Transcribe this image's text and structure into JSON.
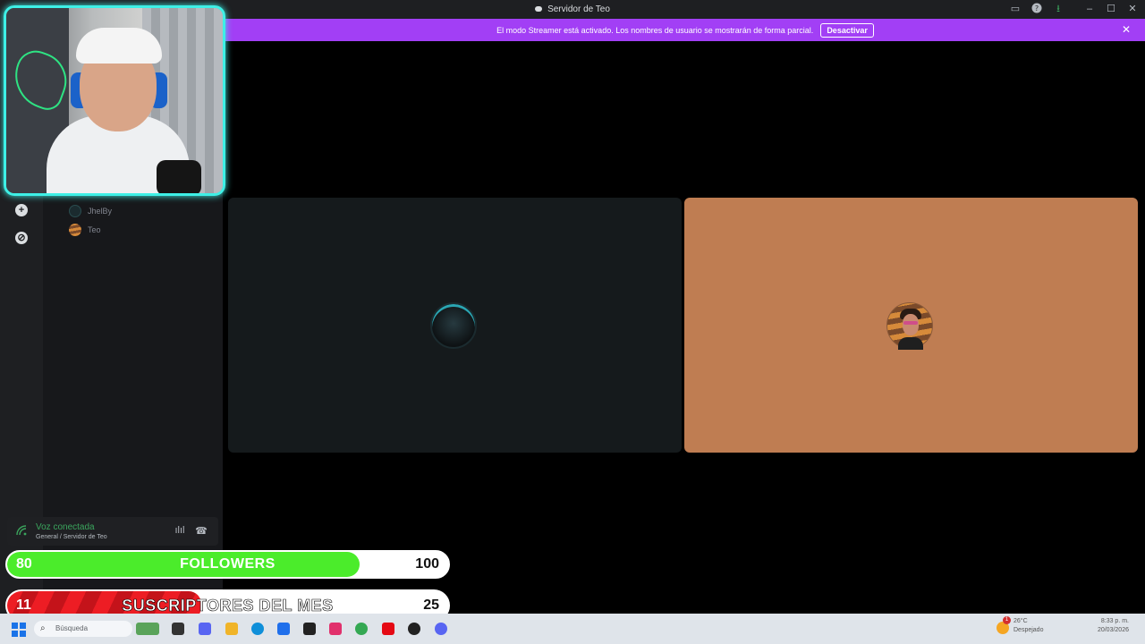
{
  "window": {
    "title": "Servidor de Teo"
  },
  "banner": {
    "message": "El modo Streamer está activado. Los nombres de usuario se mostrarán de forma parcial.",
    "button_label": "Desactivar"
  },
  "members": [
    {
      "name": "JhelBy"
    },
    {
      "name": "Teo"
    }
  ],
  "voice": {
    "status": "Voz conectada",
    "channel": "General / Servidor de Teo"
  },
  "overlay": {
    "followers": {
      "current": "80",
      "label": "FOLLOWERS",
      "goal": "100",
      "progress": 0.8
    },
    "subscribers": {
      "current": "11",
      "label": "SUSCRIPTORES DEL MES",
      "goal": "25",
      "progress": 0.44
    }
  },
  "taskbar": {
    "search_placeholder": "Búsqueda",
    "weather_temp": "26°C",
    "weather_desc": "Despejado",
    "notification_count": "1",
    "time": "8:33 p. m.",
    "date": "20/03/2026"
  },
  "colors": {
    "banner": "#a23ff5",
    "voice_connected": "#3ba55d",
    "followers_fill": "#4bec2b",
    "subscribers_fill": "#ed1d24",
    "tile_b_bg": "#bf7d52",
    "cam_border": "#3ef0e6"
  },
  "icons": [
    "discord-logo-icon",
    "inbox-icon",
    "help-icon",
    "download-icon",
    "minimize-icon",
    "maximize-icon",
    "close-icon",
    "add-server-icon",
    "explore-icon",
    "signal-icon",
    "noise-suppression-icon",
    "disconnect-icon",
    "windows-start-icon",
    "search-icon"
  ]
}
